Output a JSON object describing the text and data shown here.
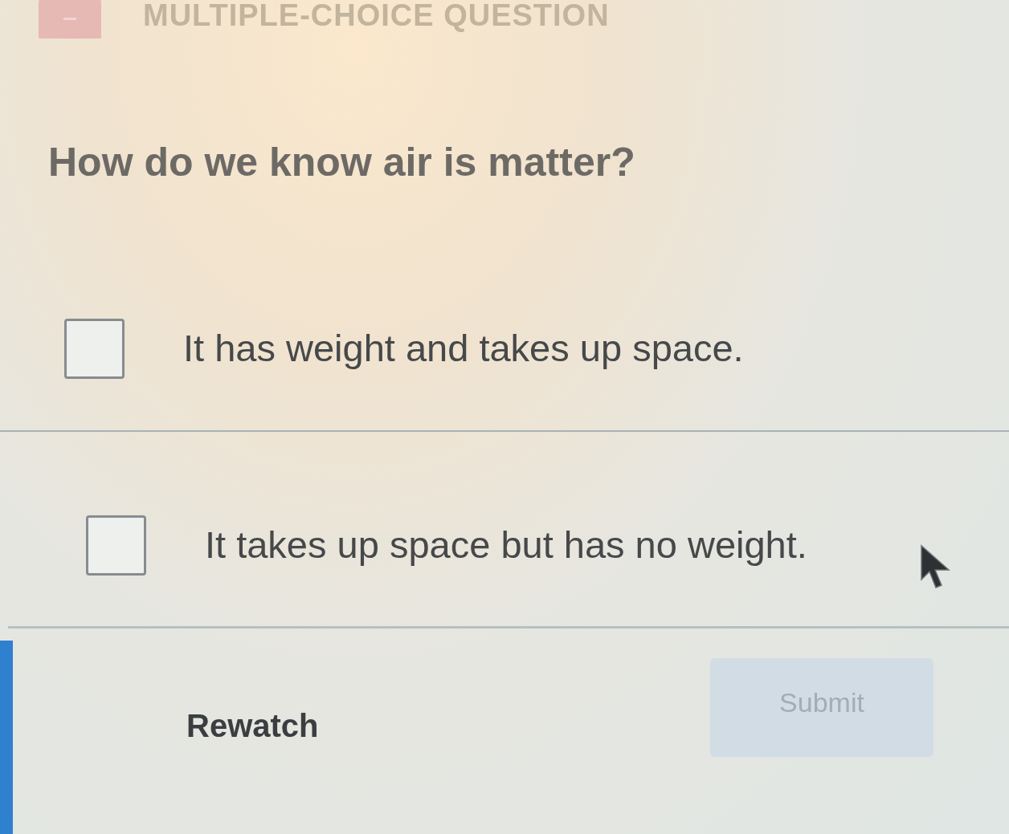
{
  "header": {
    "title": "MULTIPLE-CHOICE QUESTION"
  },
  "question": "How do we know air is matter?",
  "options": [
    {
      "text": "It has weight and takes up space.",
      "checked": false
    },
    {
      "text": "It takes up space but has no weight.",
      "checked": false
    }
  ],
  "actions": {
    "rewatch": {
      "label": "Rewatch"
    },
    "submit": {
      "label": "Submit",
      "disabled": true
    }
  }
}
